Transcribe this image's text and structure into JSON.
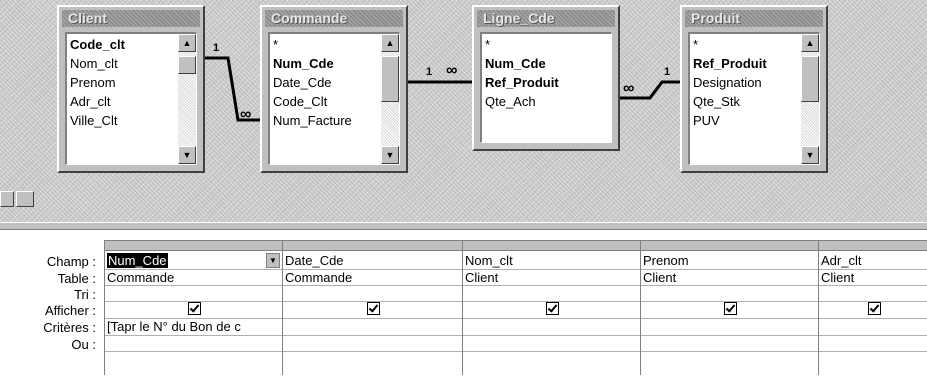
{
  "tables": [
    {
      "title": "Client",
      "fields": [
        {
          "name": "Code_clt",
          "bold": true
        },
        {
          "name": "Nom_clt",
          "bold": false
        },
        {
          "name": "Prenom",
          "bold": false
        },
        {
          "name": "Adr_clt",
          "bold": false
        },
        {
          "name": "Ville_Clt",
          "bold": false
        }
      ]
    },
    {
      "title": "Commande",
      "fields": [
        {
          "name": "*",
          "bold": false
        },
        {
          "name": "Num_Cde",
          "bold": true
        },
        {
          "name": "Date_Cde",
          "bold": false
        },
        {
          "name": "Code_Clt",
          "bold": false
        },
        {
          "name": "Num_Facture",
          "bold": false
        }
      ]
    },
    {
      "title": "Ligne_Cde",
      "fields": [
        {
          "name": "*",
          "bold": false
        },
        {
          "name": "Num_Cde",
          "bold": true
        },
        {
          "name": "Ref_Produit",
          "bold": true
        },
        {
          "name": "Qte_Ach",
          "bold": false
        }
      ]
    },
    {
      "title": "Produit",
      "fields": [
        {
          "name": "*",
          "bold": false
        },
        {
          "name": "Ref_Produit",
          "bold": true
        },
        {
          "name": "Designation",
          "bold": false
        },
        {
          "name": "Qte_Stk",
          "bold": false
        },
        {
          "name": "PUV",
          "bold": false
        }
      ]
    }
  ],
  "relations": {
    "one": "1",
    "many": "∞"
  },
  "row_labels": [
    "Champ :",
    "Table :",
    "Tri :",
    "Afficher :",
    "Critères :",
    "Ou :"
  ],
  "columns": [
    {
      "champ": "Num_Cde",
      "table": "Commande",
      "tri": "",
      "afficher": true,
      "criteres": "[Tapr le N° du Bon de c",
      "ou": ""
    },
    {
      "champ": "Date_Cde",
      "table": "Commande",
      "tri": "",
      "afficher": true,
      "criteres": "",
      "ou": ""
    },
    {
      "champ": "Nom_clt",
      "table": "Client",
      "tri": "",
      "afficher": true,
      "criteres": "",
      "ou": ""
    },
    {
      "champ": "Prenom",
      "table": "Client",
      "tri": "",
      "afficher": true,
      "criteres": "",
      "ou": ""
    },
    {
      "champ": "Adr_clt",
      "table": "Client",
      "tri": "",
      "afficher": true,
      "criteres": "",
      "ou": ""
    }
  ],
  "icons": {
    "scroll_up": "▲",
    "scroll_down": "▼",
    "dropdown": "▼"
  }
}
